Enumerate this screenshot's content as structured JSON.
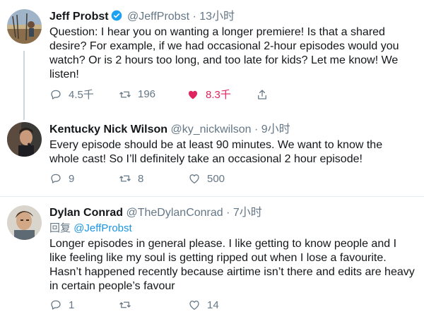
{
  "colors": {
    "link": "#1b95e0",
    "like": "#e0245e",
    "muted": "#657786",
    "verified": "#1da1f2"
  },
  "tweets": [
    {
      "name": "Jeff Probst",
      "handle": "@JeffProbst",
      "dot": "·",
      "time": "13小时",
      "verified": true,
      "text": "Question:  I hear you on wanting a longer premiere! Is that a shared\ndesire?  For example, if we had occasional 2-hour episodes would you\nwatch?  Or is 2 hours too long, and too late for kids?  Let me know!  We\nlisten!",
      "replies": "4.5千",
      "retweets": "196",
      "likes": "8.3千"
    },
    {
      "name": "Kentucky Nick Wilson",
      "handle": "@ky_nickwilson",
      "dot": "·",
      "time": "9小时",
      "text": "Every episode should be at least 90 minutes. We want to know the\nwhole cast! So I’ll definitely take an occasional 2 hour episode!",
      "replies": "9",
      "retweets": "8",
      "likes": "500"
    },
    {
      "name": "Dylan Conrad",
      "handle": "@TheDylanConrad",
      "dot": "·",
      "time": "7小时",
      "reply_label": "回复",
      "reply_mention": "@JeffProbst",
      "text": "Longer episodes in general please. I like getting to know people and I\nlike feeling like my soul is getting ripped out when I lose a favourite.\nHasn’t happened recently because airtime isn’t there and edits are heavy\nin certain people’s favour",
      "replies": "1",
      "retweets": "",
      "likes": "14"
    }
  ],
  "icons": [
    "reply-icon",
    "retweet-icon",
    "like-icon",
    "share-icon",
    "verified-icon"
  ]
}
